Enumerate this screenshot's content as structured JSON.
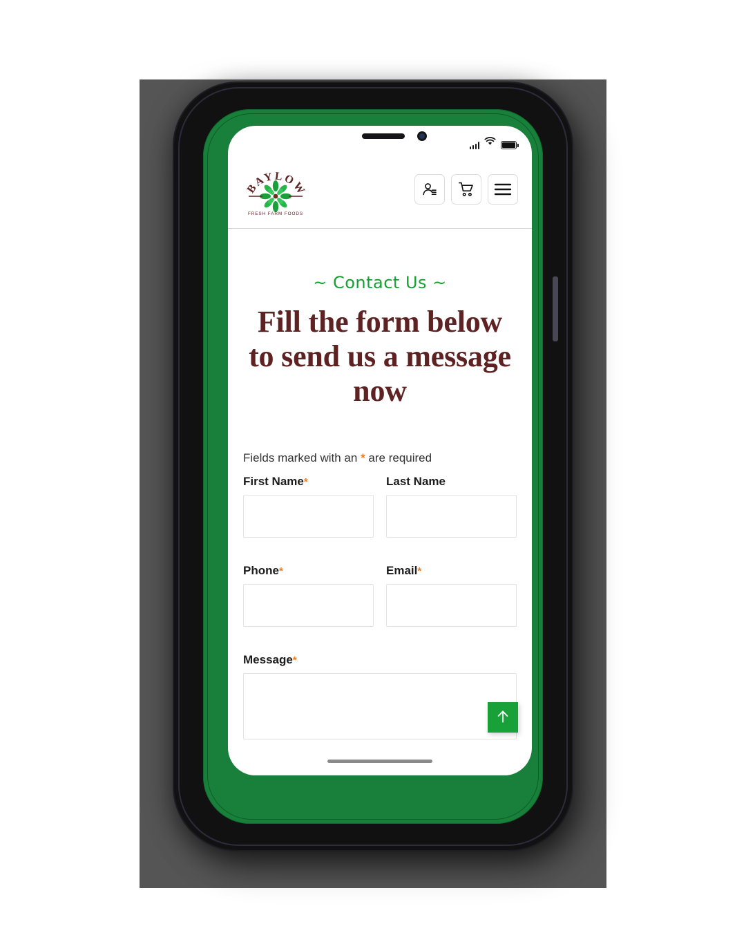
{
  "device": {
    "status_bar": {
      "signal_icon": "signal-bars-icon",
      "wifi_icon": "wifi-icon",
      "battery_icon": "battery-full-icon"
    },
    "home_indicator": "home-indicator"
  },
  "header": {
    "logo": {
      "brand": "BAYLOW",
      "tagline": "FRESH FARM FOODS",
      "mark": "leaf-rosette-icon",
      "brand_color": "#5e2222",
      "leaf_color": "#1aa03a"
    },
    "actions": [
      {
        "name": "account-button",
        "icon": "user-account-icon"
      },
      {
        "name": "cart-button",
        "icon": "shopping-cart-icon"
      },
      {
        "name": "menu-button",
        "icon": "hamburger-menu-icon"
      }
    ]
  },
  "main": {
    "eyebrow": "~ Contact Us ~",
    "headline": "Fill the form below to send us a message now",
    "required_note_before": "Fields marked with an ",
    "required_marker": "*",
    "required_note_after": " are required",
    "fields": {
      "first_name": {
        "label": "First Name",
        "required": true,
        "value": "",
        "placeholder": ""
      },
      "last_name": {
        "label": "Last Name",
        "required": false,
        "value": "",
        "placeholder": ""
      },
      "phone": {
        "label": "Phone",
        "required": true,
        "value": "",
        "placeholder": ""
      },
      "email": {
        "label": "Email",
        "required": true,
        "value": "",
        "placeholder": ""
      },
      "message": {
        "label": "Message",
        "required": true,
        "value": "",
        "placeholder": ""
      }
    },
    "scroll_top_button": {
      "icon": "arrow-up-icon",
      "color": "#18a139"
    }
  },
  "colors": {
    "accent_green": "#16a033",
    "heading_maroon": "#5e2222",
    "required_orange": "#f07c1e",
    "bezel_green": "#18803a",
    "backdrop_gray": "#555555"
  }
}
